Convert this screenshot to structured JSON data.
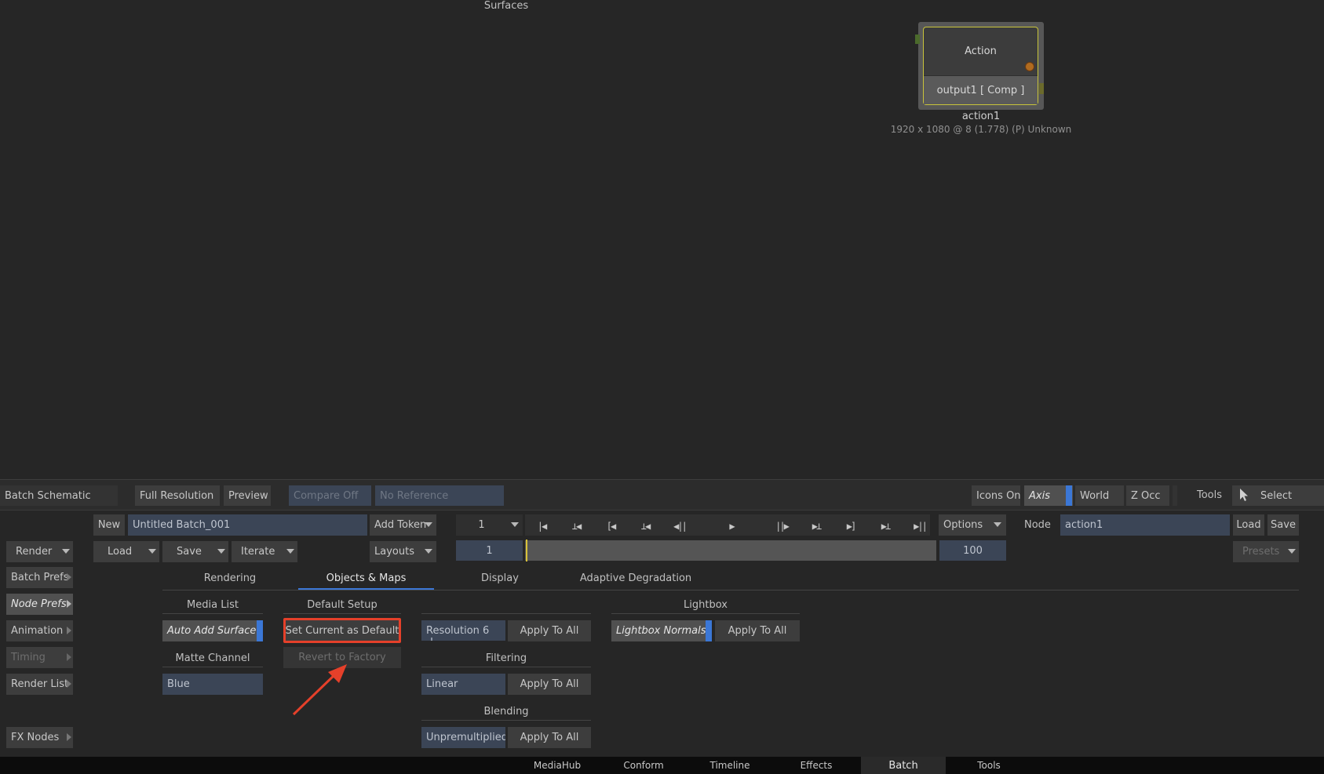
{
  "node": {
    "title": "Action",
    "output": "output1 [ Comp ]",
    "name": "action1",
    "info": "1920 x 1080 @ 8 (1.778) (P) Unknown"
  },
  "toolbar": {
    "batch_schematic": "Batch Schematic",
    "full_resolution": "Full Resolution",
    "preview": "Preview",
    "compare_off": "Compare Off",
    "no_reference": "No Reference",
    "icons_on": "Icons On",
    "axis": "Axis",
    "world": "World",
    "z_occ": "Z Occ",
    "tools": "Tools",
    "select": "Select"
  },
  "batch": {
    "new": "New",
    "name": "Untitled Batch_001",
    "add_token": "Add Token",
    "render": "Render",
    "load": "Load",
    "save": "Save",
    "iterate": "Iterate",
    "layouts": "Layouts"
  },
  "timeline": {
    "frame": "1",
    "start": "1",
    "end": "100",
    "options": "Options"
  },
  "node_panel": {
    "label": "Node",
    "value": "action1",
    "load": "Load",
    "save": "Save",
    "presets": "Presets"
  },
  "side_menu": {
    "batch_prefs": "Batch Prefs",
    "node_prefs": "Node Prefs",
    "animation": "Animation",
    "timing": "Timing",
    "render_list": "Render List",
    "fx_nodes": "FX Nodes"
  },
  "tabs": {
    "rendering": "Rendering",
    "objects_maps": "Objects & Maps",
    "display": "Display",
    "adaptive": "Adaptive Degradation"
  },
  "media_list": {
    "header": "Media List",
    "auto_add": "Auto Add Surface",
    "matte_header": "Matte Channel",
    "matte_value": "Blue"
  },
  "default_setup": {
    "header": "Default Setup",
    "set_current": "Set Current as Default",
    "revert": "Revert to Factory"
  },
  "surfaces": {
    "header": "Surfaces",
    "resolution": "Resolution 6",
    "apply": "Apply To All",
    "filtering_header": "Filtering",
    "filtering_value": "Linear",
    "filtering_apply": "Apply To All",
    "blending_header": "Blending",
    "blending_value": "Unpremultiplied",
    "blending_apply": "Apply To All"
  },
  "lightbox": {
    "header": "Lightbox",
    "normals": "Lightbox Normals",
    "apply": "Apply To All"
  },
  "bottom_tabs": [
    "MediaHub",
    "Conform",
    "Timeline",
    "Effects",
    "Batch",
    "Tools"
  ],
  "colors": {
    "accent": "#3b77d6",
    "highlight": "#e5402a",
    "node_border": "#c9c43a"
  }
}
